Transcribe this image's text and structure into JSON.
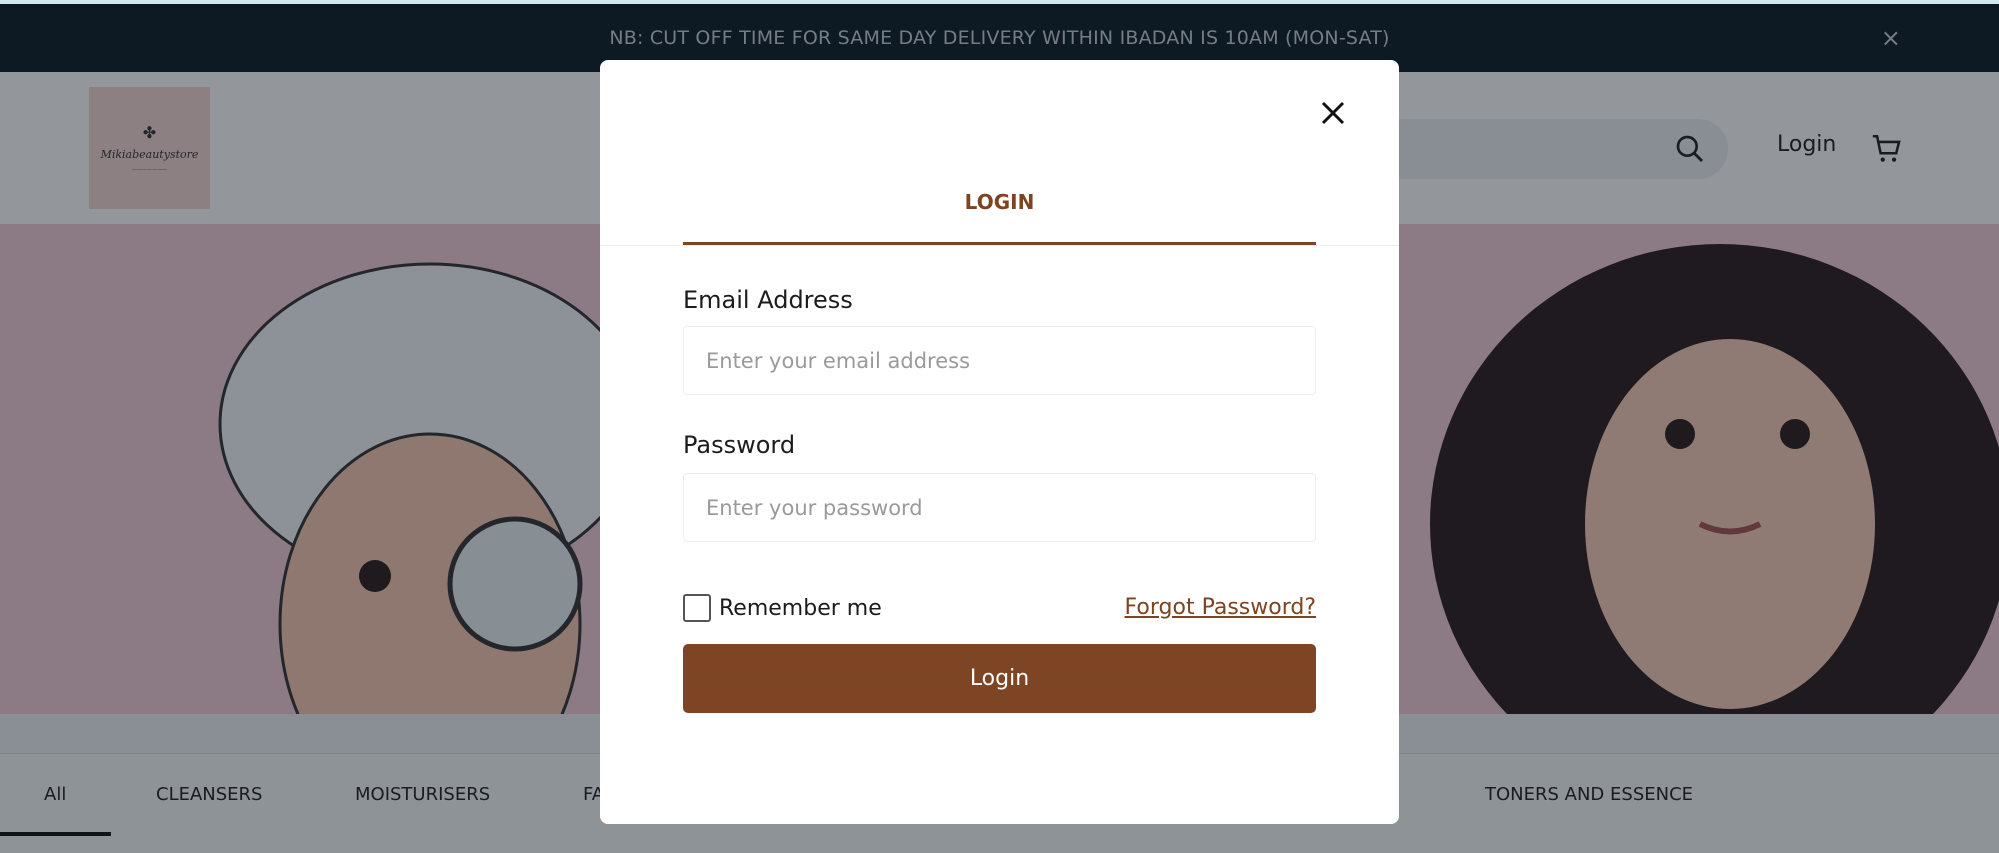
{
  "banner": {
    "text": "NB: CUT OFF TIME FOR SAME DAY DELIVERY WITHIN IBADAN IS 10AM (MON-SAT)",
    "close": "×"
  },
  "header": {
    "logo_text": "Mikiabeautystore",
    "login": "Login",
    "icons": {
      "search": "search-icon",
      "cart": "cart-icon"
    }
  },
  "categories": [
    "All",
    "CLEANSERS",
    "MOISTURISERS",
    "FA",
    "TONERS AND ESSENCE"
  ],
  "modal": {
    "tab": "LOGIN",
    "email_label": "Email Address",
    "email_placeholder": "Enter your email address",
    "password_label": "Password",
    "password_placeholder": "Enter your password",
    "remember": "Remember me",
    "forgot": "Forgot Password?",
    "submit": "Login"
  },
  "colors": {
    "accent": "#7e4524",
    "banner": "#0c1a24",
    "hero": "#f3ccd4"
  }
}
